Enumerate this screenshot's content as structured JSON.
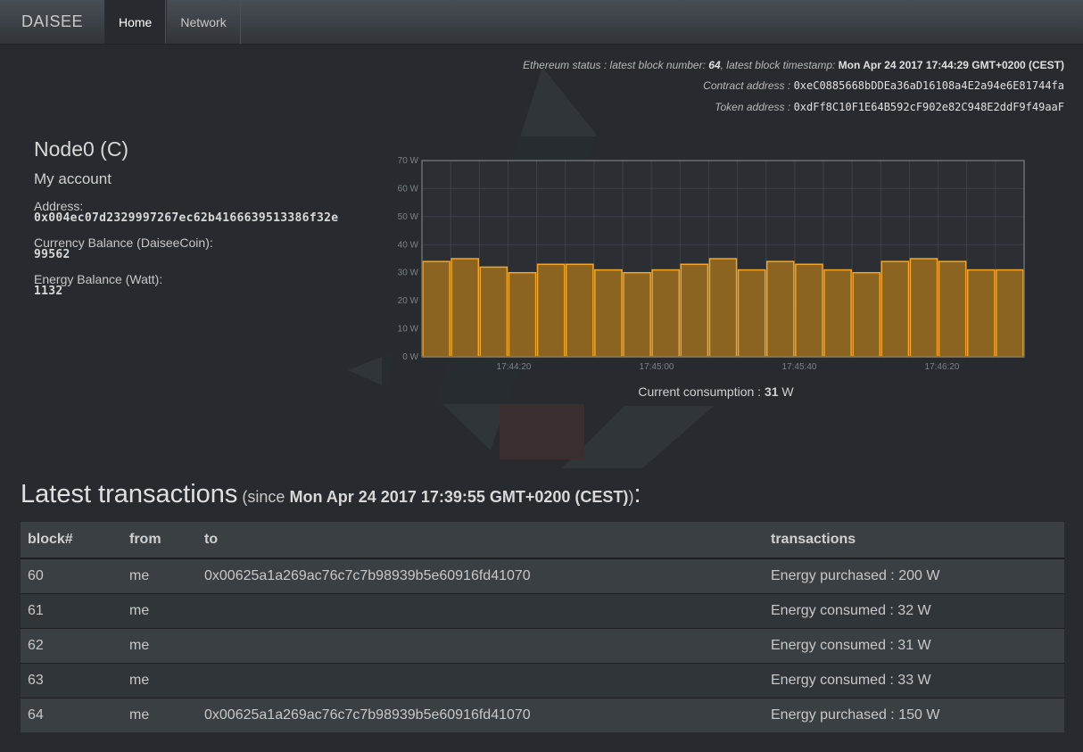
{
  "navbar": {
    "brand": "DAISEE",
    "tabs": [
      "Home",
      "Network"
    ],
    "active_tab": "Home"
  },
  "ethereum": {
    "status_prefix": "Ethereum status : latest block number: ",
    "block_number": "64",
    "timestamp_prefix": ", latest block timestamp: ",
    "timestamp": "Mon Apr 24 2017 17:44:29 GMT+0200 (CEST)",
    "contract_label": "Contract address : ",
    "contract_address": "0xeC0885668bDDEa36aD16108a4E2a94e6E81744fa",
    "token_label": "Token address : ",
    "token_address": "0xdFf8C10F1E64B592cF902e82C948E2ddF9f49aaF"
  },
  "node": {
    "title": "Node0 (C)",
    "account_heading": "My account",
    "address_label": "Address:",
    "address": "0x004ec07d2329997267ec62b4166639513386f32e",
    "currency_label": "Currency Balance (DaiseeCoin):",
    "currency": "99562",
    "energy_label": "Energy Balance (Watt):",
    "energy": "1132"
  },
  "consumption": {
    "label": "Current consumption : ",
    "value": "31",
    "unit": " W"
  },
  "chart_data": {
    "type": "bar",
    "y_ticks": [
      "0 W",
      "10 W",
      "20 W",
      "30 W",
      "40 W",
      "50 W",
      "60 W",
      "70 W"
    ],
    "ylim": [
      0,
      70
    ],
    "x_ticks": [
      "17:44:20",
      "17:45:00",
      "17:45:40",
      "17:46:20"
    ],
    "values": [
      34,
      35,
      32,
      30,
      33,
      33,
      31,
      30,
      31,
      33,
      35,
      31,
      34,
      33,
      31,
      30,
      34,
      35,
      34,
      31,
      31
    ],
    "grid": true,
    "bar_color": "#f5a623",
    "bar_fill": "#8a6420"
  },
  "transactions": {
    "title": "Latest transactions",
    "since_open": " (since ",
    "since_date": "Mon Apr 24 2017 17:39:55 GMT+0200 (CEST)",
    "since_close": ")",
    "colon": ":",
    "headers": [
      "block#",
      "from",
      "to",
      "transactions"
    ],
    "rows": [
      {
        "block": "60",
        "from": "me",
        "to": "0x00625a1a269ac76c7c7b98939b5e60916fd41070",
        "tx": "Energy purchased : 200 W"
      },
      {
        "block": "61",
        "from": "me",
        "to": "",
        "tx": "Energy consumed : 32 W"
      },
      {
        "block": "62",
        "from": "me",
        "to": "",
        "tx": "Energy consumed : 31 W"
      },
      {
        "block": "63",
        "from": "me",
        "to": "",
        "tx": "Energy consumed : 33 W"
      },
      {
        "block": "64",
        "from": "me",
        "to": "0x00625a1a269ac76c7c7b98939b5e60916fd41070",
        "tx": "Energy purchased : 150 W"
      }
    ]
  }
}
